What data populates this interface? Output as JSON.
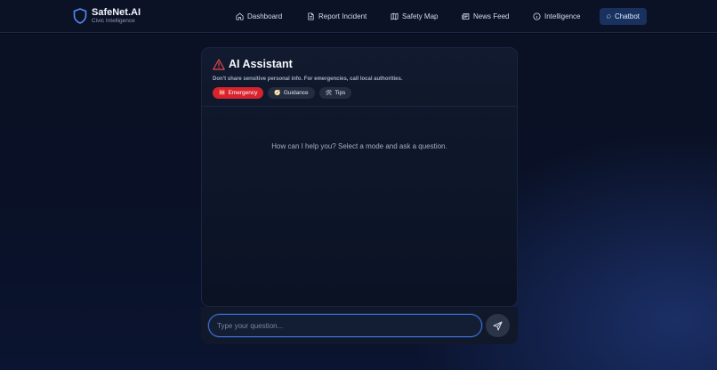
{
  "brand": {
    "name": "SafeNet.AI",
    "tagline": "Civic Intelligence"
  },
  "nav": {
    "items": [
      {
        "label": "Dashboard",
        "icon": "home-icon"
      },
      {
        "label": "Report Incident",
        "icon": "file-icon"
      },
      {
        "label": "Safety Map",
        "icon": "map-icon"
      },
      {
        "label": "News Feed",
        "icon": "newspaper-icon"
      },
      {
        "label": "Intelligence",
        "icon": "info-icon"
      },
      {
        "label": "Chatbot",
        "icon": "chat-icon",
        "active": true
      }
    ]
  },
  "assistant": {
    "title": "AI Assistant",
    "title_icon": "warning-triangle-icon",
    "disclaimer": "Don't share sensitive personal info. For emergencies, call local authorities.",
    "modes": [
      {
        "label": "Emergency",
        "icon": "🆘",
        "active": true
      },
      {
        "label": "Guidance",
        "icon": "🧭",
        "active": false
      },
      {
        "label": "Tips",
        "icon": "🛠",
        "active": false
      }
    ],
    "empty_message": "How can I help you? Select a mode and ask a question."
  },
  "composer": {
    "placeholder": "Type your question...",
    "value": "",
    "send_icon": "send-icon"
  },
  "colors": {
    "accent": "#3b6fd6",
    "emergency": "#d7232d",
    "active_nav": "#18315e",
    "warning": "#e5484d"
  }
}
